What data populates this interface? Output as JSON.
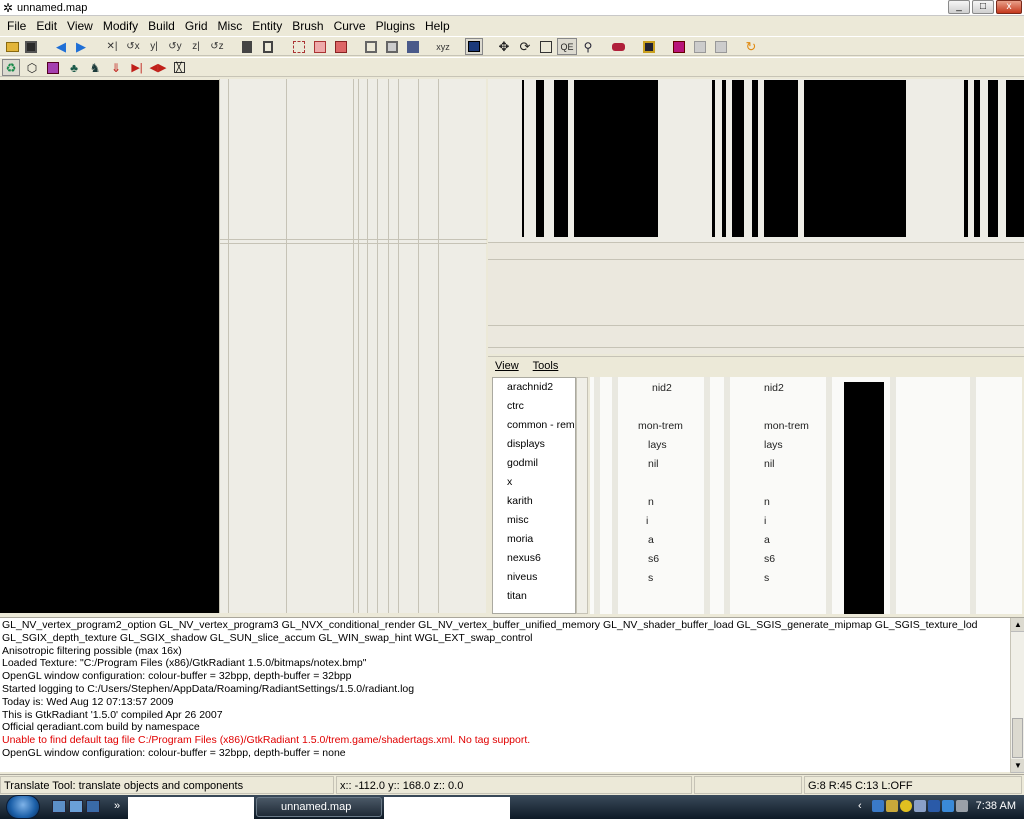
{
  "window": {
    "title": "unnamed.map",
    "min": "_",
    "max": "□",
    "close": "x"
  },
  "menu": [
    "File",
    "Edit",
    "View",
    "Modify",
    "Build",
    "Grid",
    "Misc",
    "Entity",
    "Brush",
    "Curve",
    "Plugins",
    "Help"
  ],
  "toolbar": {
    "qe_label": "QE",
    "axis_label": "xyz"
  },
  "entity_inspector": {
    "menu": [
      "View",
      "Tools"
    ],
    "entities": [
      "arachnid2",
      "ctrc",
      "common - rem",
      "displays",
      "godmil",
      "x",
      "karith",
      "misc",
      "moria",
      "nexus6",
      "niveus",
      "titan"
    ],
    "ghost_col1": [
      "nid2",
      "mon-trem",
      "lays",
      "nil",
      "n",
      "i",
      "a",
      "s6",
      "s"
    ],
    "ghost_col2": [
      "nid2",
      "mon-trem",
      "lays",
      "nil",
      "n",
      "i",
      "a",
      "s6",
      "s"
    ]
  },
  "console": {
    "lines": [
      {
        "text": "GL_NV_vertex_program2_option GL_NV_vertex_program3 GL_NVX_conditional_render GL_NV_vertex_buffer_unified_memory GL_NV_shader_buffer_load GL_SGIS_generate_mipmap GL_SGIS_texture_lod",
        "type": "info"
      },
      {
        "text": "GL_SGIX_depth_texture GL_SGIX_shadow GL_SUN_slice_accum GL_WIN_swap_hint WGL_EXT_swap_control",
        "type": "info"
      },
      {
        "text": "Anisotropic filtering possible (max 16x)",
        "type": "info"
      },
      {
        "text": "Loaded Texture: \"C:/Program Files (x86)/GtkRadiant 1.5.0/bitmaps/notex.bmp\"",
        "type": "info"
      },
      {
        "text": "OpenGL window configuration: colour-buffer = 32bpp, depth-buffer = 32bpp",
        "type": "info"
      },
      {
        "text": "Started logging to C:/Users/Stephen/AppData/Roaming/RadiantSettings/1.5.0/radiant.log",
        "type": "info"
      },
      {
        "text": "Today is: Wed Aug 12 07:13:57 2009",
        "type": "info"
      },
      {
        "text": "This is GtkRadiant '1.5.0' compiled Apr 26 2007",
        "type": "info"
      },
      {
        "text": "Official qeradiant.com build by namespace",
        "type": "info"
      },
      {
        "text": "Unable to find default tag file C:/Program Files (x86)/GtkRadiant 1.5.0/trem.game/shadertags.xml. No tag support.",
        "type": "error"
      },
      {
        "text": "OpenGL window configuration: colour-buffer = 32bpp, depth-buffer = none",
        "type": "info"
      }
    ]
  },
  "status": {
    "tool": "Translate Tool: translate objects and components",
    "coords": "x:: -112.0  y::  168.0  z::    0.0",
    "grid": "G:8  R:45  C:13  L:OFF"
  },
  "taskbar": {
    "task_title": "unnamed.map",
    "clock": "7:38 AM",
    "more": "»"
  },
  "colors": {
    "error_text": "#e00000",
    "chrome": "#ece9d8"
  }
}
